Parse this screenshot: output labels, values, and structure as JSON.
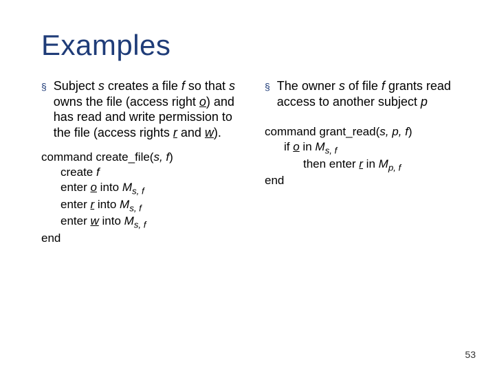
{
  "title": "Examples",
  "bullet_symbol": "§",
  "left": {
    "text_parts": {
      "a": "Subject ",
      "s1": "s",
      "b": " creates a file ",
      "f": "f",
      "c": " so that ",
      "s2": "s",
      "d": " owns the file (access right ",
      "o": "o",
      "e": ") and has read and write permission to the file (access rights ",
      "r": "r",
      "g": " and  ",
      "w": "w",
      "h": ")."
    },
    "cmd": {
      "head_a": "command create_file(",
      "head_b": "s, f",
      "head_c": ")",
      "l1_a": "create ",
      "l1_b": "f",
      "l2_a": "enter ",
      "l2_b": "o",
      "l2_c": "  into ",
      "l2_d": "M",
      "l2_sub": "s, f",
      "l3_a": "enter ",
      "l3_b": "r",
      "l3_c": " into ",
      "l3_d": "M",
      "l3_sub": "s, f",
      "l4_a": "enter ",
      "l4_b": "w",
      "l4_c": " into ",
      "l4_d": "M",
      "l4_sub": "s, f",
      "end": "end"
    }
  },
  "right": {
    "text_parts": {
      "a": "The owner ",
      "s": "s",
      "b": " of file ",
      "f": "f",
      "c": " grants read access to another subject ",
      "p": "p"
    },
    "cmd": {
      "head_a": "command grant_read(",
      "head_b": "s, p, f",
      "head_c": ")",
      "l1_a": "if ",
      "l1_b": "o",
      "l1_c": " in ",
      "l1_d": "M",
      "l1_sub": "s, f",
      "l2_a": "then enter ",
      "l2_b": "r",
      "l2_c": " in ",
      "l2_d": "M",
      "l2_sub": "p, f",
      "end": "end"
    }
  },
  "page_number": "53"
}
